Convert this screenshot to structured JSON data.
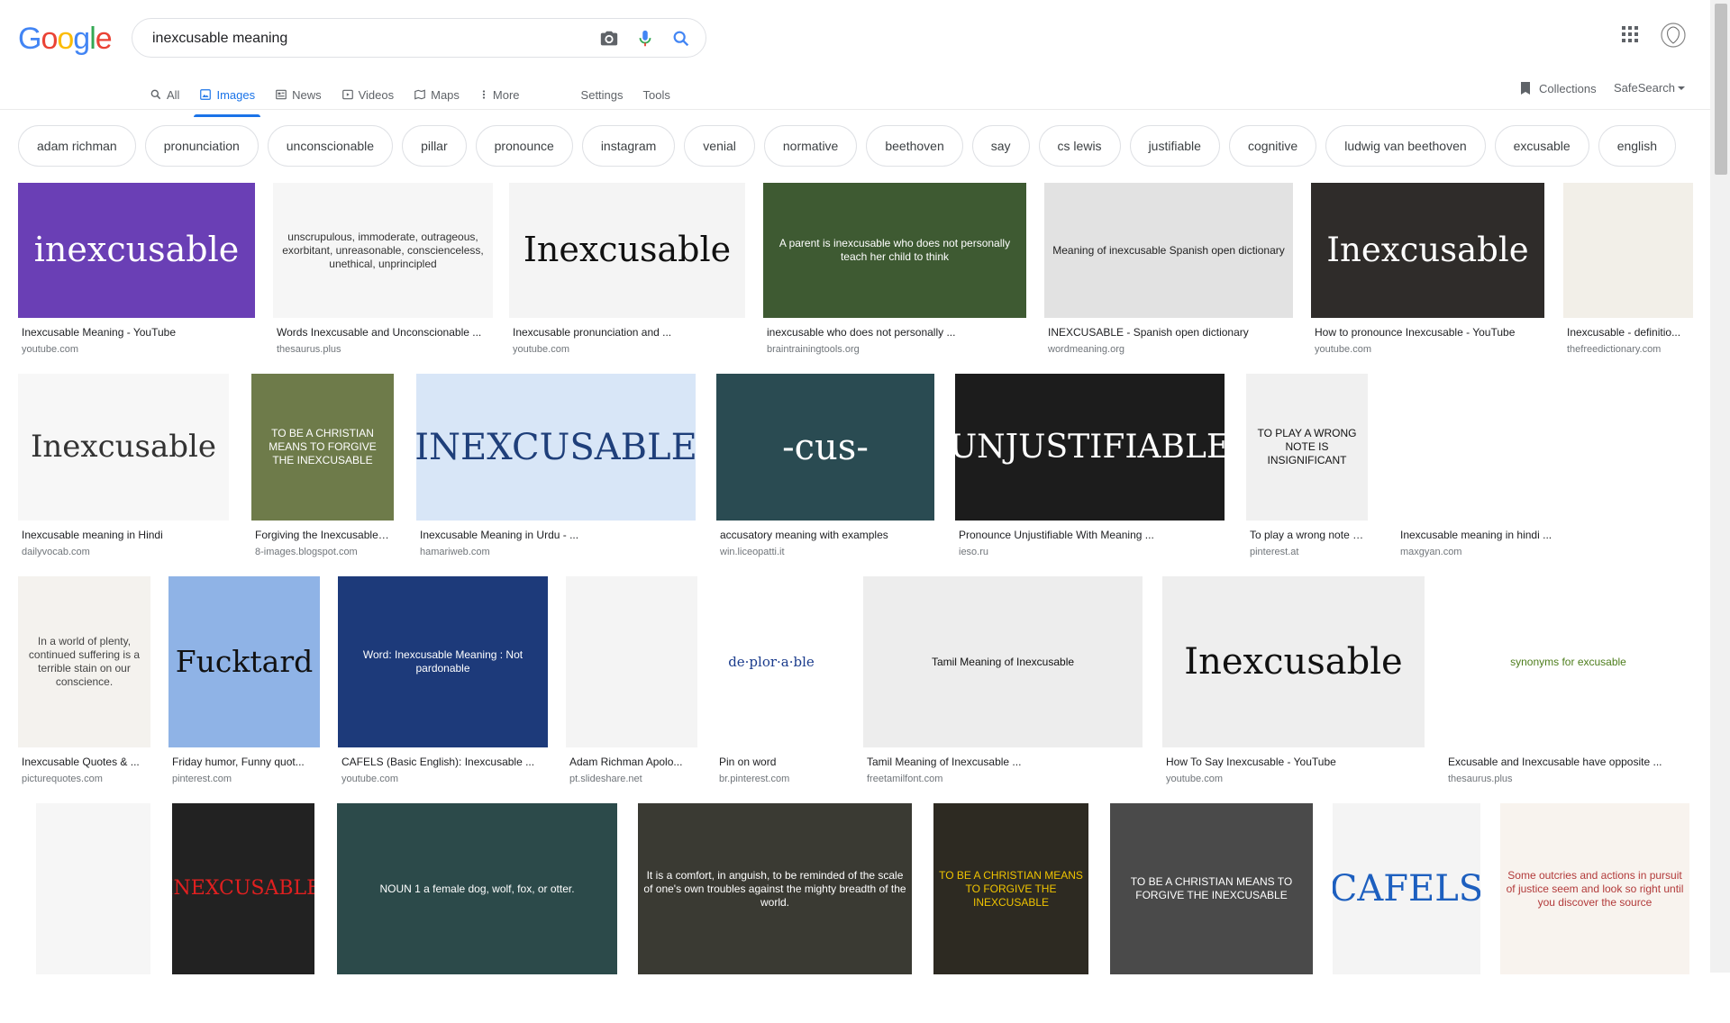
{
  "logo": {
    "text": "Google",
    "colors": [
      "#4285F4",
      "#EA4335",
      "#FBBC05",
      "#4285F4",
      "#34A853",
      "#EA4335"
    ]
  },
  "search": {
    "value": "inexcusable meaning"
  },
  "tabs": [
    {
      "label": "All",
      "icon": "search-icon"
    },
    {
      "label": "Images",
      "icon": "image-icon",
      "active": true
    },
    {
      "label": "News",
      "icon": "news-icon"
    },
    {
      "label": "Videos",
      "icon": "video-icon"
    },
    {
      "label": "Maps",
      "icon": "map-icon"
    },
    {
      "label": "More",
      "icon": "more-vert-icon"
    }
  ],
  "settings_label": "Settings",
  "tools_label": "Tools",
  "collections_label": "Collections",
  "safesearch_label": "SafeSearch",
  "chips": [
    "adam richman",
    "pronunciation",
    "unconscionable",
    "pillar",
    "pronounce",
    "instagram",
    "venial",
    "normative",
    "beethoven",
    "say",
    "cs lewis",
    "justifiable",
    "cognitive",
    "ludwig van beethoven",
    "excusable",
    "english"
  ],
  "results": [
    {
      "title": "Inexcusable Meaning - YouTube",
      "source": "youtube.com",
      "thumb_text": "inexcusable",
      "bg": "#6a3fb5",
      "fg": "#ffffff"
    },
    {
      "title": "Words Inexcusable and Unconscionable ...",
      "source": "thesaurus.plus",
      "thumb_text": "unscrupulous, immoderate, outrageous, exorbitant, unreasonable, conscienceless, unethical, unprincipled",
      "bg": "#f6f6f6",
      "fg": "#333333"
    },
    {
      "title": "Inexcusable pronunciation and ...",
      "source": "youtube.com",
      "thumb_text": "Inexcusable",
      "bg": "#f4f4f4",
      "fg": "#111111"
    },
    {
      "title": "inexcusable who does not personally ...",
      "source": "braintrainingtools.org",
      "thumb_text": "A parent is inexcusable who does not personally teach her child to think",
      "bg": "#3e5a32",
      "fg": "#ffffff"
    },
    {
      "title": "INEXCUSABLE - Spanish open dictionary",
      "source": "wordmeaning.org",
      "thumb_text": "Meaning of inexcusable Spanish open dictionary",
      "bg": "#e2e2e2",
      "fg": "#222222"
    },
    {
      "title": "How to pronounce Inexcusable - YouTube",
      "source": "youtube.com",
      "thumb_text": "Inexcusable",
      "bg": "#2f2c2a",
      "fg": "#ffffff"
    },
    {
      "title": "Inexcusable - definitio...",
      "source": "thefreedictionary.com",
      "thumb_text": "",
      "bg": "#f2efe8",
      "fg": "#333333"
    },
    {
      "title": "Inexcusable meaning in Hindi",
      "source": "dailyvocab.com",
      "thumb_text": "Inexcusable",
      "bg": "#f7f7f7",
      "fg": "#333333"
    },
    {
      "title": "Forgiving the Inexcusable,...",
      "source": "8-images.blogspot.com",
      "thumb_text": "TO BE A CHRISTIAN MEANS TO FORGIVE THE INEXCUSABLE",
      "bg": "#6e7b4a",
      "fg": "#ffffff"
    },
    {
      "title": "Inexcusable Meaning in Urdu - ...",
      "source": "hamariweb.com",
      "thumb_text": "INEXCUSABLE",
      "bg": "#d8e6f7",
      "fg": "#1f3f7a"
    },
    {
      "title": "accusatory meaning with examples",
      "source": "win.liceopatti.it",
      "thumb_text": "-cus-",
      "bg": "#2a4b52",
      "fg": "#ffffff"
    },
    {
      "title": "Pronounce Unjustifiable With Meaning ...",
      "source": "ieso.ru",
      "thumb_text": "UNJUSTIFIABLE",
      "bg": "#1c1c1c",
      "fg": "#ffffff"
    },
    {
      "title": "To play a wrong note is...",
      "source": "pinterest.at",
      "thumb_text": "TO PLAY A WRONG NOTE IS INSIGNIFICANT",
      "bg": "#f0f0f0",
      "fg": "#111111"
    },
    {
      "title": "Inexcusable meaning in hindi ...",
      "source": "maxgyan.com",
      "thumb_text": "",
      "bg": "#ffffff",
      "fg": "#3b6fd8"
    },
    {
      "title": "Inexcusable Quotes & ...",
      "source": "picturequotes.com",
      "thumb_text": "In a world of plenty, continued suffering is a terrible stain on our conscience.",
      "bg": "#f4f2ee",
      "fg": "#444444"
    },
    {
      "title": "Friday humor, Funny quot...",
      "source": "pinterest.com",
      "thumb_text": "Fucktard",
      "bg": "#8fb3e6",
      "fg": "#111111"
    },
    {
      "title": "CAFELS (Basic English): Inexcusable ...",
      "source": "youtube.com",
      "thumb_text": "Word: Inexcusable Meaning : Not pardonable",
      "bg": "#1d3a7a",
      "fg": "#ffffff"
    },
    {
      "title": "Adam Richman Apolo...",
      "source": "pt.slideshare.net",
      "thumb_text": "",
      "bg": "#f4f4f4",
      "fg": "#333333"
    },
    {
      "title": "Pin on word",
      "source": "br.pinterest.com",
      "thumb_text": "de·plor·a·ble",
      "bg": "#ffffff",
      "fg": "#1a3b8c"
    },
    {
      "title": "Tamil Meaning of Inexcusable ...",
      "source": "freetamilfont.com",
      "thumb_text": "Tamil Meaning of Inexcusable",
      "bg": "#ededed",
      "fg": "#111111"
    },
    {
      "title": "How To Say Inexcusable - YouTube",
      "source": "youtube.com",
      "thumb_text": "Inexcusable",
      "bg": "#eeeeee",
      "fg": "#111111"
    },
    {
      "title": "Excusable and Inexcusable have opposite ...",
      "source": "thesaurus.plus",
      "thumb_text": "synonyms for excusable",
      "bg": "#ffffff",
      "fg": "#4d7d1c"
    },
    {
      "title": "",
      "source": "",
      "thumb_text": "",
      "bg": "#f6f6f6",
      "fg": "#333333"
    },
    {
      "title": "",
      "source": "",
      "thumb_text": "INEXCUSABLE",
      "bg": "#222222",
      "fg": "#e02020"
    },
    {
      "title": "",
      "source": "",
      "thumb_text": "NOUN 1 a female dog, wolf, fox, or otter.",
      "bg": "#2c4a4a",
      "fg": "#ffffff"
    },
    {
      "title": "",
      "source": "",
      "thumb_text": "It is a comfort, in anguish, to be reminded of the scale of one's own troubles against the mighty breadth of the world.",
      "bg": "#3a3a33",
      "fg": "#ffffff"
    },
    {
      "title": "",
      "source": "",
      "thumb_text": "TO BE A CHRISTIAN MEANS TO FORGIVE THE INEXCUSABLE",
      "bg": "#2d2a22",
      "fg": "#f0c400"
    },
    {
      "title": "",
      "source": "",
      "thumb_text": "TO BE A CHRISTIAN MEANS TO FORGIVE THE INEXCUSABLE",
      "bg": "#4a4a4a",
      "fg": "#ffffff"
    },
    {
      "title": "",
      "source": "",
      "thumb_text": "CAFELS",
      "bg": "#f4f4f4",
      "fg": "#1d5fbf"
    },
    {
      "title": "",
      "source": "",
      "thumb_text": "Some outcries and actions in pursuit of justice seem and look so right until you discover the source",
      "bg": "#f8f3ee",
      "fg": "#b23a3a"
    }
  ]
}
